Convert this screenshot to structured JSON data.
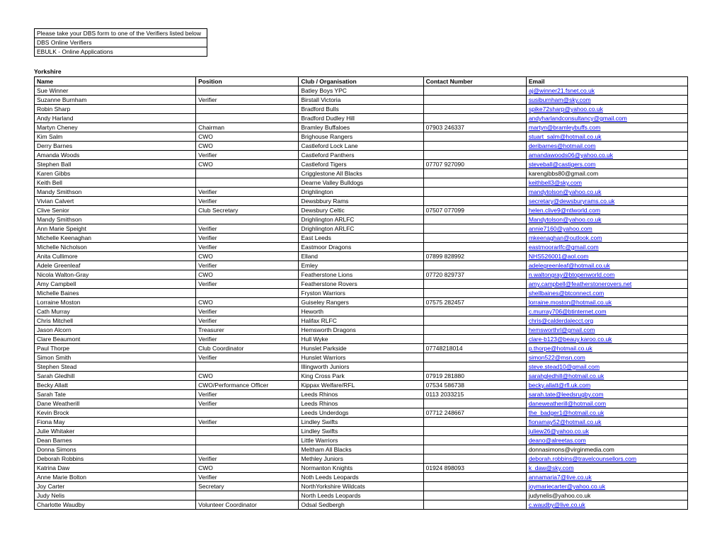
{
  "header": {
    "lines": [
      "Please take your DBS form to one of the Verifiers listed below",
      "DBS Online Verifiers",
      "EBULK - Online Applications"
    ]
  },
  "region": "Yorkshire",
  "columns": [
    "Name",
    "Position",
    "Club / Organisation",
    "Contact Number",
    "Email"
  ],
  "rows": [
    {
      "name": "Sue Winner",
      "position": "",
      "org": "Batley Boys YPC",
      "number": "",
      "email": "aj@winner21.fsnet.co.uk"
    },
    {
      "name": "Suzanne Burnham",
      "position": "Verifier",
      "org": "Birstall Victoria",
      "number": "",
      "email": "susiburnham@sky.com"
    },
    {
      "name": "Robin Sharp",
      "position": "",
      "org": "Bradford Bulls",
      "number": "",
      "email": "spike72sharp@yahoo.co.uk"
    },
    {
      "name": "Andy Harland",
      "position": "",
      "org": "Bradford Dudley Hill",
      "number": "",
      "email": "andyharlandconsultancy@gmail.com"
    },
    {
      "name": "Martyn Cheney",
      "position": "Chairman",
      "org": "Bramley Buffaloes",
      "number": "07903 246337",
      "email": "martyn@bramleybuffs.com"
    },
    {
      "name": "Kim Salm",
      "position": "CWO",
      "org": "Brighouse Rangers",
      "number": "",
      "email": "stuart_salm@hotmail.co.uk"
    },
    {
      "name": "Derry Barnes",
      "position": "CWO",
      "org": "Castleford Lock Lane",
      "number": "",
      "email": "deribarnes@hotmail.com"
    },
    {
      "name": "Amanda Woods",
      "position": "Verifier",
      "org": "Castleford Panthers",
      "number": "",
      "email": "amandawoods06@yahoo.co.uk"
    },
    {
      "name": "Stephen Ball",
      "position": "CWO",
      "org": "Castleford Tigers",
      "number": "07707 927090",
      "email": "steveball@castigers.com"
    },
    {
      "name": "Karen Gibbs",
      "position": "",
      "org": "Crigglestone All Blacks",
      "number": "",
      "email": "karengibbs80@gmail.com",
      "email_plain": true
    },
    {
      "name": "Keith Bell",
      "position": "",
      "org": "Dearne Valley Bulldogs",
      "number": "",
      "email": "keithbell3@sky.com"
    },
    {
      "name": "Mandy Smithson",
      "position": "Verifier",
      "org": "Drighlington",
      "number": "",
      "email": "mandytolson@yahoo.co.uk"
    },
    {
      "name": "Vivian Calvert",
      "position": "Verifier",
      "org": "Dewsbbury Rams",
      "number": "",
      "email": "secretary@dewsburyrams.co.uk"
    },
    {
      "name": "Clive Senior",
      "position": " Club Secretary",
      "org": "Dewsbury Celtic",
      "number": "07507 077099",
      "email": " helen.clive9@ntlworld.com"
    },
    {
      "name": "Mandy Smithson",
      "position": "",
      "org": "Drighlington ARLFC",
      "number": "",
      "email": "Mandytolson@yahoo.co.uk"
    },
    {
      "name": "Ann Marie Speight",
      "position": "Verifier",
      "org": "Drighlington ARLFC",
      "number": "",
      "email": "annie7160@yahoo.com"
    },
    {
      "name": "Michelle Keenaghan",
      "position": "Verifier",
      "org": "East Leeds",
      "number": "",
      "email": "mkeenaghan@outlook.com"
    },
    {
      "name": "Michelle Nicholson",
      "position": "Verifier",
      "org": "Eastmoor Dragons",
      "number": "",
      "email": "eastmoorarlfc@gmail.com"
    },
    {
      "name": "Anita Cullimore",
      "position": "CWO",
      "org": "Elland",
      "number": "07899 828992",
      "email": "NHS526001@aol.com"
    },
    {
      "name": "Adele Greenleaf",
      "position": "Verifier",
      "org": "Emley",
      "number": "",
      "email": "adelegreenleaf@hotmail.co.uk"
    },
    {
      "name": "Nicola Walton-Gray",
      "position": "CWO",
      "org": "Featherstone Lions",
      "number": "07720 829737",
      "email": "n.waltongray@btopenworld.com"
    },
    {
      "name": "Amy Campbell",
      "position": "Verifier",
      "org": "Featherstone Rovers",
      "number": "",
      "email": "amy.campbell@featherstonerovers.net"
    },
    {
      "name": "Michelle Baines",
      "position": "",
      "org": "Fryston Warriors",
      "number": "",
      "email": "shellbaines@btconnect.com"
    },
    {
      "name": "Lorraine Moston",
      "position": "CWO",
      "org": "Guiseley Rangers",
      "number": "07575 282457",
      "email": "lorraine.moston@hotmail.co.uk"
    },
    {
      "name": "Cath Murray",
      "position": "Verifier",
      "org": "Heworth",
      "number": "",
      "email": "c.murray706@btinternet.com"
    },
    {
      "name": "Chris Mitchell",
      "position": "Verifier",
      "org": "Halifax RLFC",
      "number": "",
      "email": "chris@calderdalecct.org"
    },
    {
      "name": "Jason Alcorn",
      "position": "Treasurer",
      "org": "Hemsworth Dragons",
      "number": "",
      "email": "hemsworthrl@gmail.com"
    },
    {
      "name": "Clare Beaumont",
      "position": "Verifier",
      "org": "Hull Wyke",
      "number": "",
      "email": "clare-b123@beauy.karoo.co.uk"
    },
    {
      "name": "Paul Thorpe",
      "position": "Club Coordinator",
      "org": "Hunslet Parkside",
      "number": "07748218014",
      "email": "p.thorpe@hotmail.co.uk"
    },
    {
      "name": "Simon Smith",
      "position": "Verifier",
      "org": "Hunslet Warriors",
      "number": "",
      "email": "simon522@msn.com"
    },
    {
      "name": "Stephen Stead",
      "position": "",
      "org": "Illingworth Juniors",
      "number": "",
      "email": "steve.stead10@gmail.com"
    },
    {
      "name": "Sarah Gledhill",
      "position": "CWO",
      "org": "King Cross Park",
      "number": "07919 281880",
      "email": "sarahgledhill@hotmail.co.uk"
    },
    {
      "name": "Becky Allatt",
      "position": "CWO/Performance Officer",
      "org": "Kippax Welfare/RFL",
      "number": "07534 586738",
      "email": "becky.allatt@rfl.uk.com"
    },
    {
      "name": "Sarah Tate",
      "position": "Verifier",
      "org": "Leeds Rhinos",
      "number": "0113 2033215",
      "email": "sarah.tate@leedsrugby.com"
    },
    {
      "name": "Dane Weatherill",
      "position": "Verifier",
      "org": "Leeds Rhinos",
      "number": "",
      "email": "daneweatherill@hotmail.com"
    },
    {
      "name": "Kevin Brock",
      "position": "",
      "org": "Leeds Underdogs",
      "number": "07712 248667",
      "email": "the_badger1@hotmail.co.uk"
    },
    {
      "name": "Fiona May",
      "position": "Verifier",
      "org": "Lindley Swifts",
      "number": "",
      "email": "fionamay52@hotmail.co.uk"
    },
    {
      "name": "Julie Whitaker",
      "position": "",
      "org": "Lindley Swifts",
      "number": "",
      "email": "juliew26@yahoo.co.uk"
    },
    {
      "name": "Dean Barnes",
      "position": "",
      "org": "Little Warriors",
      "number": "",
      "email": "deano@alreetas.com"
    },
    {
      "name": "Donna Simons",
      "position": "",
      "org": "Meltham All Blacks",
      "number": "",
      "email": "donnasimons@virginmedia.com",
      "email_plain": true
    },
    {
      "name": "Deborah Robbins",
      "position": "Verifier",
      "org": "Methley Juniors",
      "number": "",
      "email": "deborah.robbins@travelcounsellors.com"
    },
    {
      "name": "Katrina Daw",
      "position": "CWO",
      "org": "Normanton Knights",
      "number": "01924 898093",
      "email": "k_daw@sky.com"
    },
    {
      "name": "Anne Marie Bolton",
      "position": "Verifier",
      "org": "Noth Leeds Leopards",
      "number": "",
      "email": "annamaria7@live.co.uk"
    },
    {
      "name": "Joy Carter",
      "position": "Secretary",
      "org": "NorthYorkshire Wildcats",
      "number": "",
      "email": "joymariecarter@yahoo.co.uk"
    },
    {
      "name": "Judy Nelis",
      "position": "",
      "org": "North Leeds Leopards",
      "number": "",
      "email": "judynelis@yahoo.co.uk",
      "email_plain": true
    },
    {
      "name": "Charlotte Waudby",
      "position": "Volunteer Coordinator",
      "org": "Odsal Sedbergh",
      "number": "",
      "email": "c.waudby@live.co.uk"
    }
  ]
}
